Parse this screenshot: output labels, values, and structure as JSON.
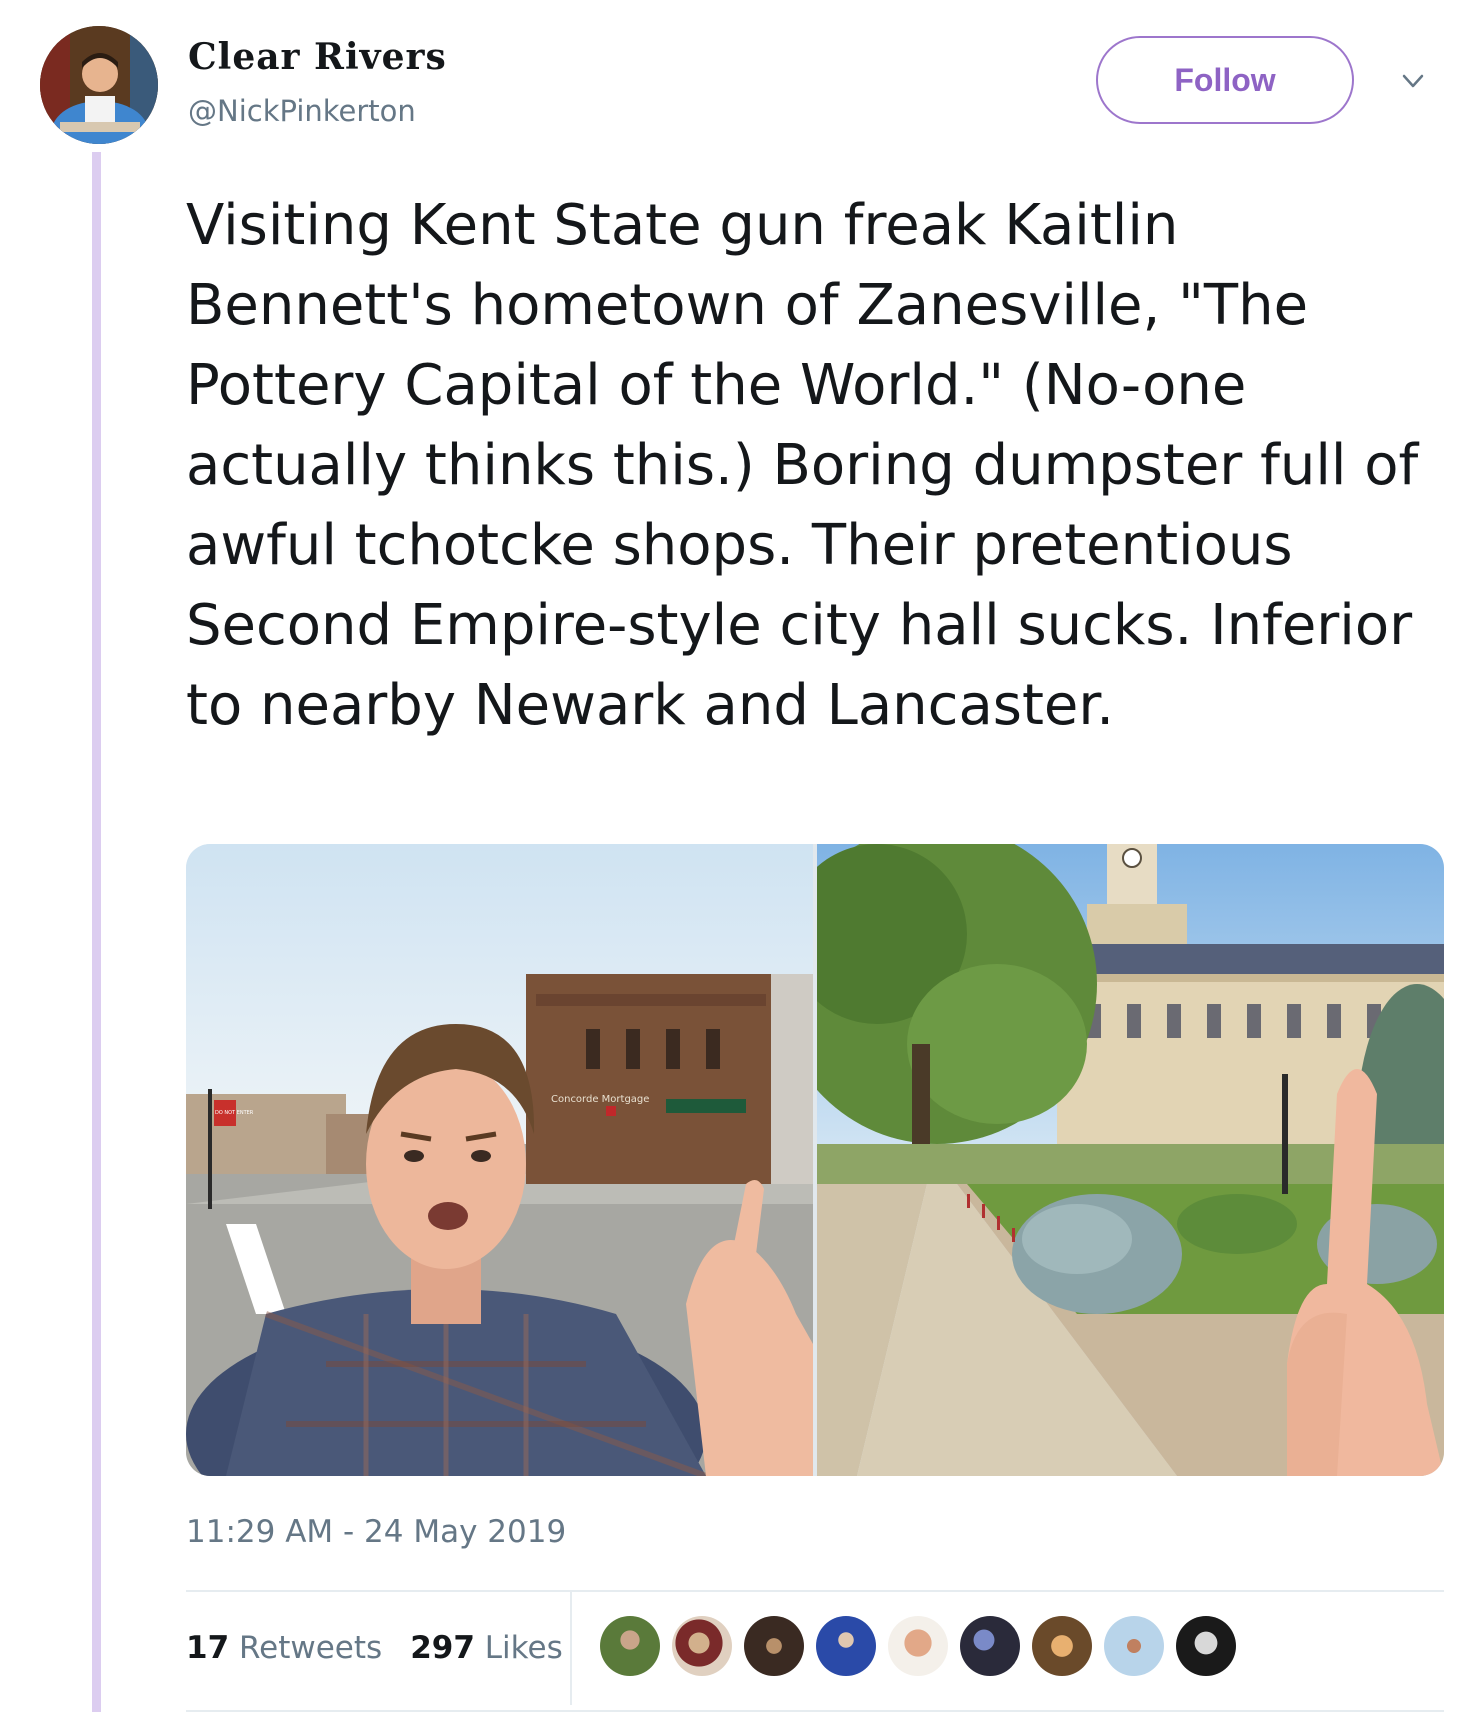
{
  "user": {
    "display_name": "Clear Rivers",
    "handle": "@NickPinkerton",
    "avatar_icon": "profile-avatar"
  },
  "actions": {
    "follow_label": "Follow",
    "more_icon": "chevron-down-icon"
  },
  "tweet": {
    "text": "Visiting Kent State gun freak Kaitlin Bennett's hometown of Zanesville, \"The Pottery Capital of the World.\" (No-one actually thinks this.) Boring dumpster full of awful tchotcke shops. Their pretentious Second Empire-style city hall sucks. Inferior to nearby Newark and Lancaster.",
    "timestamp": "11:29 AM - 24 May 2019"
  },
  "media": {
    "photo_1_signs": [
      "Concorde Mortgage",
      "DO NOT ENTER"
    ]
  },
  "stats": {
    "retweets_count": "17",
    "retweets_label": "Retweets",
    "likes_count": "297",
    "likes_label": "Likes"
  },
  "colors": {
    "accent": "#8e63c4",
    "thread_line": "#dccdf0",
    "secondary_text": "#657786"
  }
}
